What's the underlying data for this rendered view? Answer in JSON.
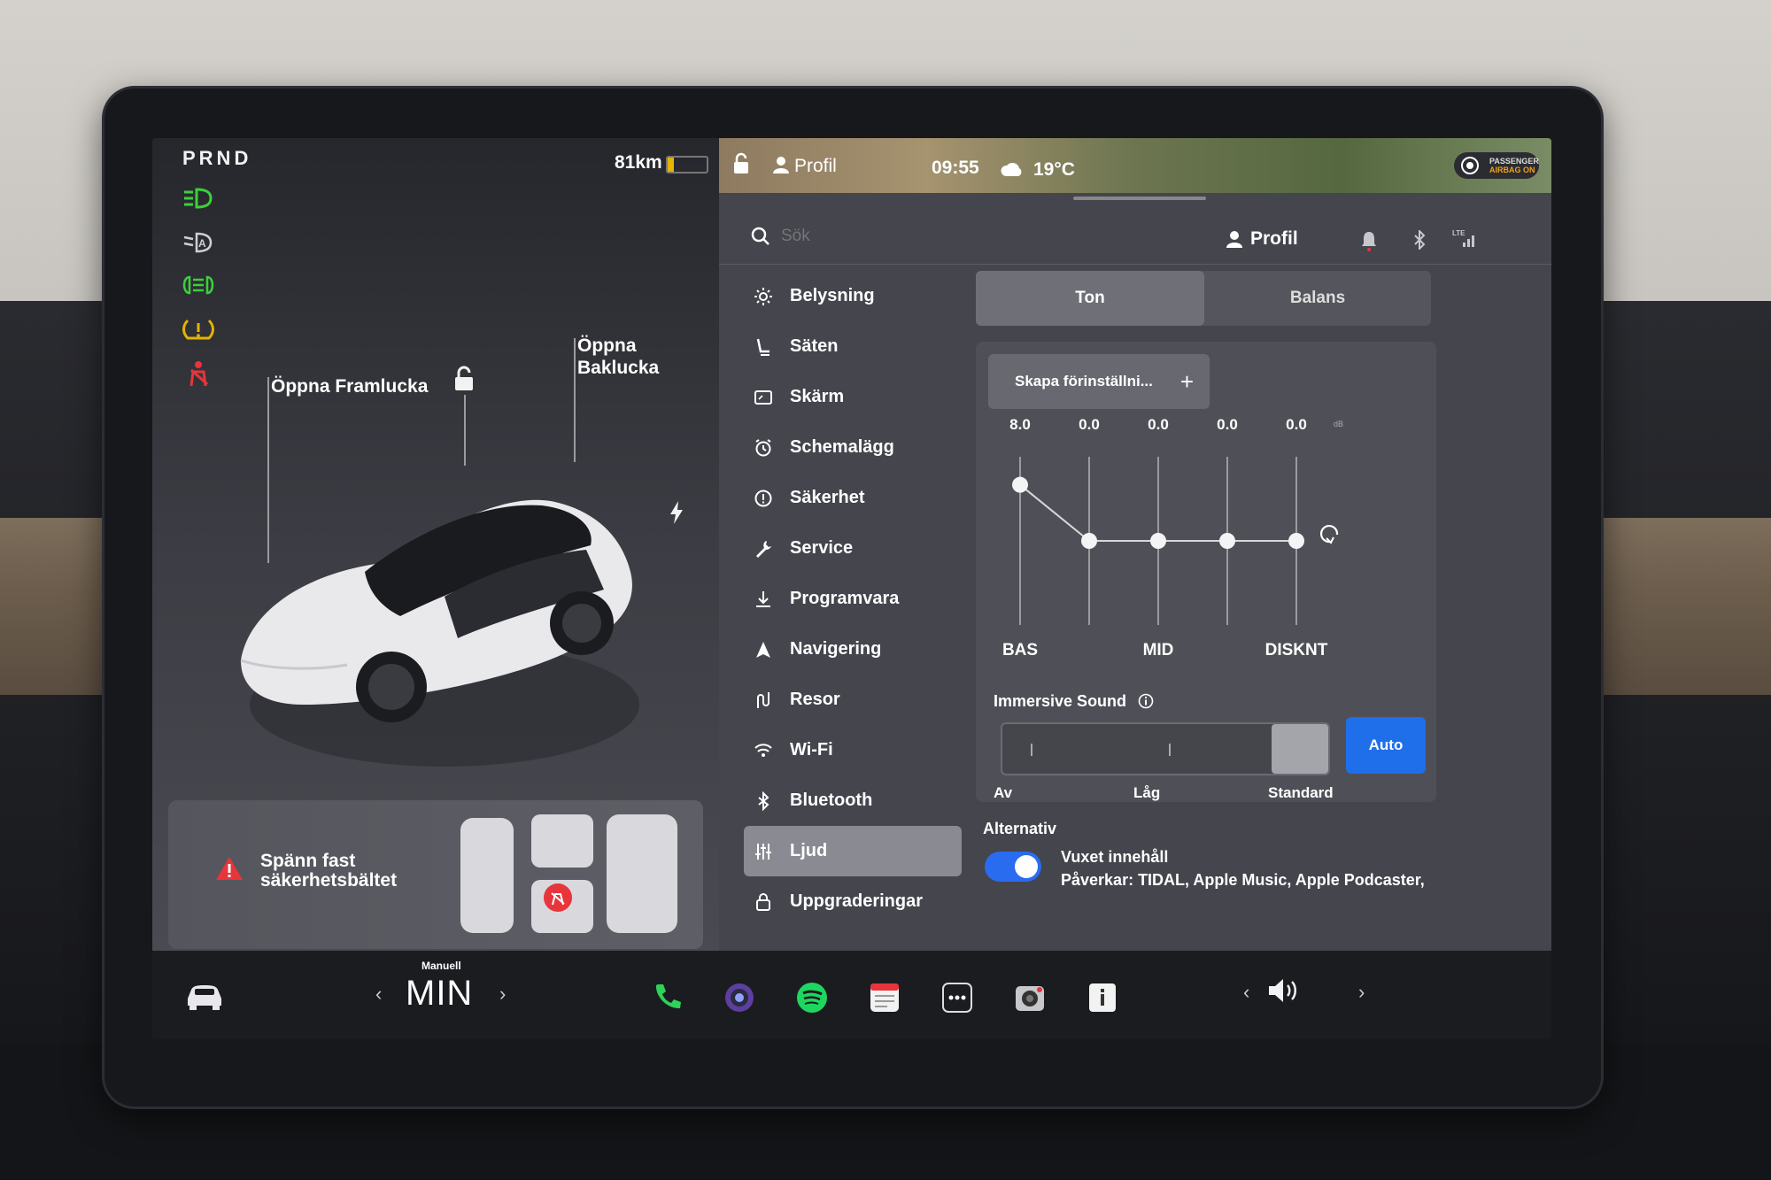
{
  "vehicle": {
    "gear": "PRND",
    "range": "81km",
    "battery_fraction": 0.15,
    "callout_front": "Öppna Framlucka",
    "callout_rear": "Öppna Baklucka",
    "seatbelt_warning": "Spänn fast säkerhetsbältet",
    "telltales": [
      "headlight-on-icon",
      "auto-headlight-icon",
      "fog-light-icon",
      "tpms-warning-icon",
      "seatbelt-warning-icon"
    ],
    "colors": {
      "green": "#3ad13a",
      "amber": "#e4b400",
      "red": "#e8343b"
    }
  },
  "status": {
    "profile_label": "Profil",
    "clock": "09:55",
    "temperature": "19°C",
    "airbag_line1": "PASSENGER",
    "airbag_line2": "AIRBAG ON"
  },
  "topbar": {
    "search_placeholder": "Sök",
    "profile_label": "Profil"
  },
  "menu": [
    {
      "icon": "sun-icon",
      "label": "Belysning"
    },
    {
      "icon": "seat-icon",
      "label": "Säten"
    },
    {
      "icon": "display-icon",
      "label": "Skärm"
    },
    {
      "icon": "alarm-clock-icon",
      "label": "Schemalägg"
    },
    {
      "icon": "alert-circle-icon",
      "label": "Säkerhet"
    },
    {
      "icon": "wrench-icon",
      "label": "Service"
    },
    {
      "icon": "download-icon",
      "label": "Programvara"
    },
    {
      "icon": "navigation-arrow-icon",
      "label": "Navigering"
    },
    {
      "icon": "route-icon",
      "label": "Resor"
    },
    {
      "icon": "wifi-icon",
      "label": "Wi-Fi"
    },
    {
      "icon": "bluetooth-icon",
      "label": "Bluetooth"
    },
    {
      "icon": "equalizer-icon",
      "label": "Ljud",
      "active": true
    },
    {
      "icon": "lock-bag-icon",
      "label": "Uppgraderingar"
    }
  ],
  "audio": {
    "tabs": [
      "Ton",
      "Balans"
    ],
    "active_tab": "Ton",
    "preset_button": "Skapa förinställni...",
    "eq_values": [
      "8.0",
      "0.0",
      "0.0",
      "0.0",
      "0.0"
    ],
    "eq_levels": [
      8.0,
      0.0,
      0.0,
      0.0,
      0.0
    ],
    "eq_range": [
      -12,
      12
    ],
    "db_unit": "dB",
    "eq_labels": {
      "bass": "BAS",
      "mid": "MID",
      "treble": "DISKNT"
    },
    "immersive_title": "Immersive Sound",
    "immersive_levels": [
      "Av",
      "Låg",
      "Standard"
    ],
    "immersive_selected": "Standard",
    "auto_label": "Auto",
    "options_title": "Alternativ",
    "option_name": "Vuxet innehåll",
    "option_desc": "Påverkar: TIDAL, Apple Music, Apple Podcaster,",
    "option_enabled": true
  },
  "dock": {
    "mode_label": "Manuell",
    "mode_value": "MIN",
    "apps": [
      "phone-icon",
      "camera-lens-icon",
      "spotify-icon",
      "calendar-icon",
      "more-icon",
      "dashcam-icon",
      "info-icon"
    ],
    "volume_icon": "speaker-volume-icon"
  }
}
